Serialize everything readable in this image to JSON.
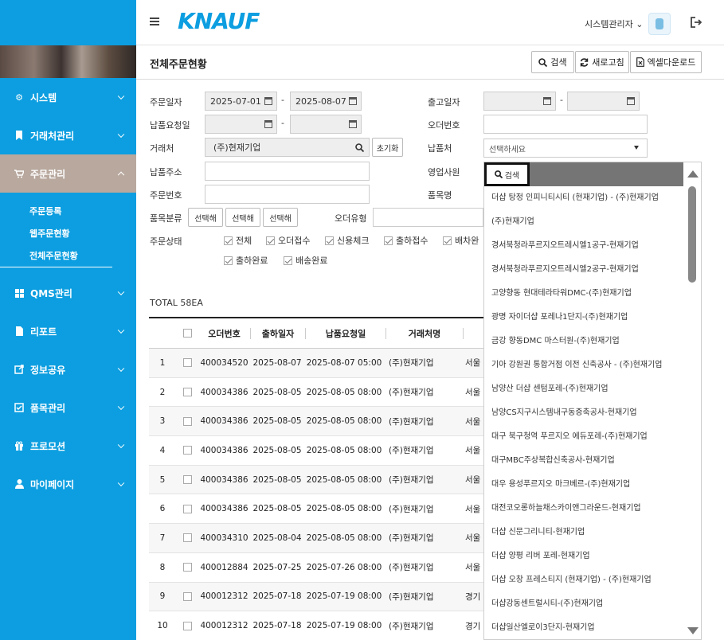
{
  "brand": "KNAUF",
  "user": {
    "name": "시스템관리자",
    "chevron": "⌄"
  },
  "sidebar": {
    "items": [
      {
        "label": "시스템",
        "icon": "gear-icon"
      },
      {
        "label": "거래처관리",
        "icon": "bookmark-icon"
      },
      {
        "label": "주문관리",
        "icon": "cart-icon"
      },
      {
        "label": "QMS관리",
        "icon": "grid-icon"
      },
      {
        "label": "리포트",
        "icon": "file-icon"
      },
      {
        "label": "정보공유",
        "icon": "share-icon"
      },
      {
        "label": "품목관리",
        "icon": "check-square-icon"
      },
      {
        "label": "프로모션",
        "icon": "gift-icon"
      },
      {
        "label": "마이페이지",
        "icon": "user-icon"
      }
    ],
    "submenu": [
      "주문등록",
      "웹주문현황",
      "전체주문현황"
    ]
  },
  "page": {
    "title": "전체주문현황",
    "buttons": {
      "search": "검색",
      "refresh": "새로고침",
      "excel": "엑셀다운로드"
    }
  },
  "form": {
    "order_date_label": "주문일자",
    "order_date_from": "2025-07-01",
    "order_date_to": "2025-08-07",
    "ship_date_label": "출고일자",
    "delivery_req_label": "납품요청일",
    "order_no_label": "오더번호",
    "vendor_label": "거래처",
    "vendor_value": "(주)현재기업",
    "reset_label": "초기화",
    "dest_label": "납품처",
    "dest_placeholder": "선택하세요",
    "address_label": "납품주소",
    "sales_label": "영업사원",
    "order_num_label": "주문번호",
    "item_name_label": "품목명",
    "category_label": "품목분류",
    "category_btn": "선택해",
    "order_type_label": "오더유형",
    "status_label": "주문상태",
    "status_options": [
      "전체",
      "오더접수",
      "신용체크",
      "출하접수",
      "배차완",
      "출하완료",
      "배송완료"
    ]
  },
  "table": {
    "total": "TOTAL 58EA",
    "headers": [
      "오더번호",
      "출하일자",
      "납품요청일",
      "거래처명"
    ],
    "rows": [
      [
        "1",
        "400034520",
        "2025-08-07",
        "2025-08-07 05:00",
        "(주)현재기업",
        "서울"
      ],
      [
        "2",
        "400034386",
        "2025-08-05",
        "2025-08-05 08:00",
        "(주)현재기업",
        "서울"
      ],
      [
        "3",
        "400034386",
        "2025-08-05",
        "2025-08-05 08:00",
        "(주)현재기업",
        "서울"
      ],
      [
        "4",
        "400034386",
        "2025-08-05",
        "2025-08-05 08:00",
        "(주)현재기업",
        "서울"
      ],
      [
        "5",
        "400034386",
        "2025-08-05",
        "2025-08-05 08:00",
        "(주)현재기업",
        "서울"
      ],
      [
        "6",
        "400034386",
        "2025-08-05",
        "2025-08-05 08:00",
        "(주)현재기업",
        "서울"
      ],
      [
        "7",
        "400034310",
        "2025-08-04",
        "2025-08-05 08:00",
        "(주)현재기업",
        "서울"
      ],
      [
        "8",
        "400012884",
        "2025-07-25",
        "2025-07-26 08:00",
        "(주)현재기업",
        "서울"
      ],
      [
        "9",
        "400012312",
        "2025-07-18",
        "2025-07-19 08:00",
        "(주)현재기업",
        "경기"
      ],
      [
        "10",
        "400012312",
        "2025-07-18",
        "2025-07-19 08:00",
        "(주)현재기업",
        "경기"
      ]
    ]
  },
  "dropdown": {
    "search_label": "검색",
    "items": [
      "더샵 탕정 인피니티시티 (현재기업) - (주)현재기업",
      "(주)현재기업",
      "경서북청라푸르지오트레시엘1공구-현재기업",
      "경서북청라푸르지오트레시엘2공구-현재기업",
      "고양향동 현대테라타워DMC-(주)현재기업",
      "광명 자이더샵 포레나1단지-(주)현재기업",
      "금강 향동DMC 마스터원-(주)현재기업",
      "기아 강원권 통합거점 이전 신축공사 - (주)현재기업",
      "남양산 더샵 센텀포레-(주)현재기업",
      "남양CS지구시스템내구동증축공사-현재기업",
      "대구 북구청역 푸르지오 에듀포레-(주)현재기업",
      "대구MBC주상복합신축공사-현재기업",
      "대우 용성푸르지오 마크베르-(주)현재기업",
      "대전코오롱하늘채스카이앤그라운드-현재기업",
      "더샵 신문그리니티-현재기업",
      "더샵 양평 리버 포레-현재기업",
      "더샵 오창 프레스티지 (현재기업) - (주)현재기업",
      "더샵강동센트럴시티-(주)현재기업",
      "더샵일산엘로이3단지-현재기업"
    ]
  }
}
